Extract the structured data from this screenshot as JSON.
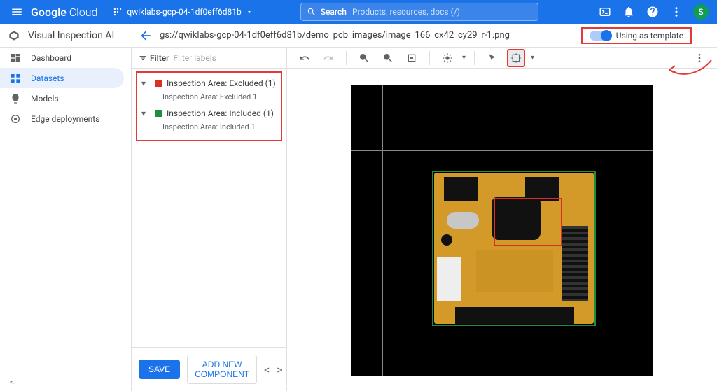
{
  "header": {
    "brand_prefix": "Google",
    "brand_suffix": "Cloud",
    "project": "qwiklabs-gcp-04-1df0eff6d81b",
    "search_label": "Search",
    "search_placeholder": "Products, resources, docs (/)",
    "avatar_initial": "S"
  },
  "subheader": {
    "product": "Visual Inspection AI",
    "path": "gs://qwiklabs-gcp-04-1df0eff6d81b/demo_pcb_images/image_166_cx42_cy29_r-1.png",
    "toggle_label": "Using as template"
  },
  "sidebar": {
    "items": [
      {
        "label": "Dashboard"
      },
      {
        "label": "Datasets"
      },
      {
        "label": "Models"
      },
      {
        "label": "Edge deployments"
      }
    ]
  },
  "labels": {
    "filter_label": "Filter",
    "filter_placeholder": "Filter labels",
    "groups": [
      {
        "title": "Inspection Area: Excluded (1)",
        "child": "Inspection Area: Excluded 1",
        "color": "red"
      },
      {
        "title": "Inspection Area: Included (1)",
        "child": "Inspection Area: Included 1",
        "color": "green"
      }
    ],
    "save": "SAVE",
    "add_component": "ADD NEW COMPONENT"
  }
}
